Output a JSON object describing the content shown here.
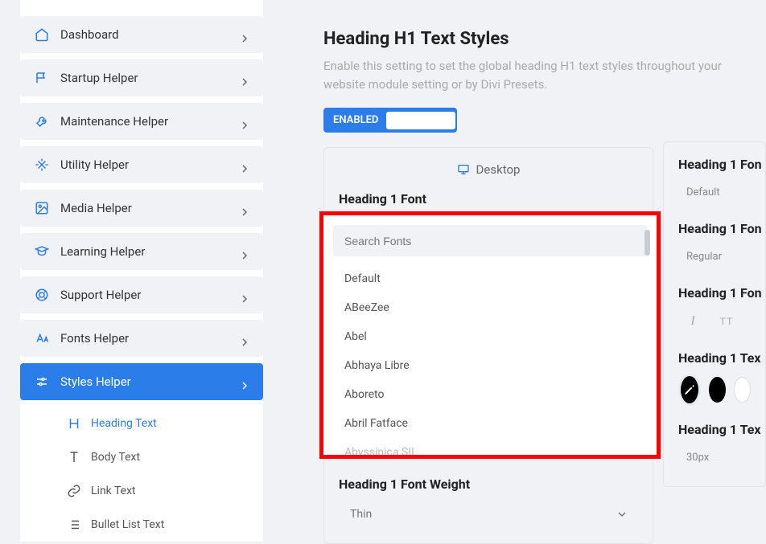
{
  "sidebar": {
    "items": [
      {
        "label": "Dashboard"
      },
      {
        "label": "Startup Helper"
      },
      {
        "label": "Maintenance Helper"
      },
      {
        "label": "Utility Helper"
      },
      {
        "label": "Media Helper"
      },
      {
        "label": "Learning Helper"
      },
      {
        "label": "Support Helper"
      },
      {
        "label": "Fonts Helper"
      },
      {
        "label": "Styles Helper"
      }
    ],
    "sub_items": [
      {
        "label": "Heading Text"
      },
      {
        "label": "Body Text"
      },
      {
        "label": "Link Text"
      },
      {
        "label": "Bullet List Text"
      }
    ]
  },
  "page": {
    "title": "Heading H1 Text Styles",
    "description": "Enable this setting to set the global heading H1 text styles throughout your website module setting or by Divi Presets.",
    "enabled_label": "ENABLED"
  },
  "panel": {
    "device": "Desktop",
    "font_label": "Heading 1 Font",
    "search_placeholder": "Search Fonts",
    "fonts": [
      "Default",
      "ABeeZee",
      "Abel",
      "Abhaya Libre",
      "Aboreto",
      "Abril Fatface",
      "Abyssinica SIL"
    ],
    "weight_label": "Heading 1 Font Weight",
    "weight_value": "Thin"
  },
  "right": {
    "f1_label": "Heading 1 Fon",
    "f1_value": "Default",
    "f2_label": "Heading 1 Fon",
    "f2_value": "Regular",
    "f3_label": "Heading 1 Fon",
    "italic": "I",
    "tt": "TT",
    "f4_label": "Heading 1 Tex",
    "f5_label": "Heading 1 Tex",
    "f5_value": "30px"
  }
}
